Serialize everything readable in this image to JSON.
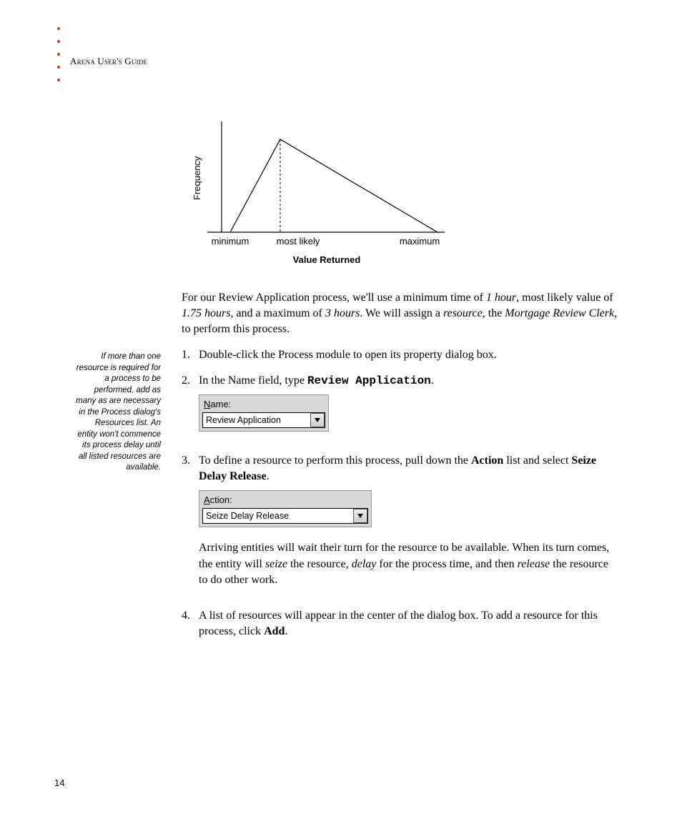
{
  "header": "Arena User's Guide",
  "chart_data": {
    "type": "line",
    "title": "",
    "xlabel": "Value Returned",
    "ylabel": "Frequency",
    "x_tick_labels": [
      "minimum",
      "most likely",
      "maximum"
    ],
    "series": [
      {
        "name": "triangular-pdf",
        "points": [
          {
            "x_label": "minimum",
            "y": 0
          },
          {
            "x_label": "most likely",
            "y": 1
          },
          {
            "x_label": "maximum",
            "y": 0
          }
        ]
      }
    ],
    "annotations": [
      "dashed vertical line at most likely"
    ]
  },
  "intro": {
    "pre1": "For our Review Application process, we'll use a minimum time of ",
    "hour1": "1 hour",
    "mid1": ", most likely value of ",
    "hour175": "1.75 hours",
    "mid2": ", and a maximum of ",
    "hour3": "3 hours",
    "mid3": ". We will assign a ",
    "resource_word": "resource",
    "mid4": ", the ",
    "clerk": "Mortgage Review Clerk",
    "tail": ", to perform this process."
  },
  "steps": {
    "s1": {
      "num": "1.",
      "text": "Double-click the Process module to open its property dialog box."
    },
    "s2": {
      "num": "2.",
      "pre": "In the Name field, type ",
      "value": "Review Application",
      "post": "."
    },
    "s3": {
      "num": "3.",
      "pre": "To define a resource to perform this process, pull down the ",
      "action_word": "Action",
      "mid": " list and select ",
      "seize": "Seize Delay Release",
      "post": "."
    },
    "s3b": {
      "pre": "Arriving entities will wait their turn for the resource to be available. When its turn comes, the entity will ",
      "seize": "seize",
      "mid1": " the resource, ",
      "delay": "delay",
      "mid2": " for the process time, and then ",
      "release": "release",
      "tail": " the resource to do other work."
    },
    "s4": {
      "num": "4.",
      "pre": "A list of resources will appear in the center of the dialog box. To add a resource for this process, click ",
      "add": "Add",
      "post": "."
    }
  },
  "ui": {
    "name": {
      "N": "N",
      "ame": "ame:",
      "value": "Review Application"
    },
    "action": {
      "A": "A",
      "ction": "ction:",
      "value": "Seize Delay Release"
    }
  },
  "sidenote": "If more than one resource is required for a process to be performed, add as many as are necessary in the Process dialog's Resources list. An entity won't commence its process delay until all listed resources are available.",
  "pagenum": "14"
}
